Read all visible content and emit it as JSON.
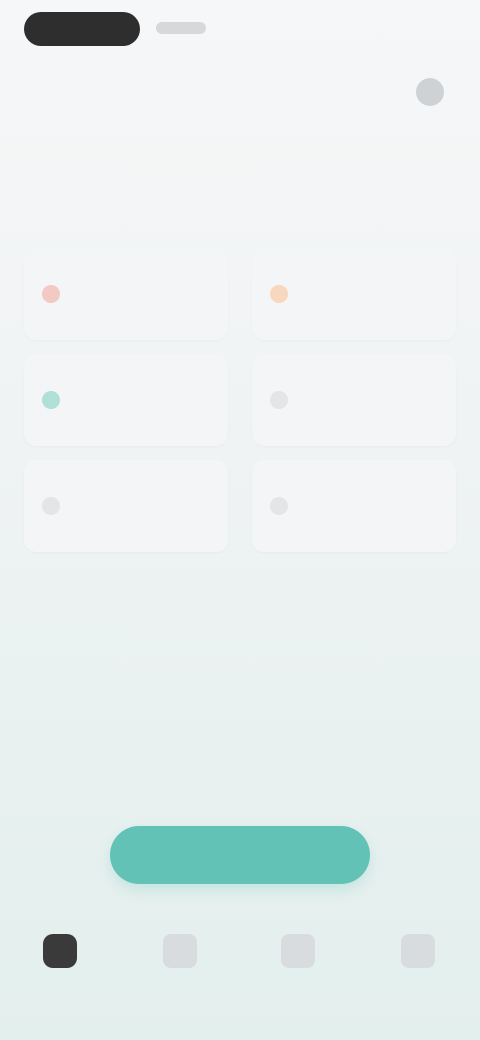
{
  "status_bar": {
    "time": "",
    "right_text": ""
  },
  "header": {
    "left_text": "",
    "right_text": ""
  },
  "section_label": "",
  "cards": [
    {
      "label": "",
      "icon": "red-circle-icon",
      "color": "#f3c9c4"
    },
    {
      "label": "",
      "icon": "orange-circle-icon",
      "color": "#f7d7be"
    },
    {
      "label": "",
      "icon": "teal-circle-icon",
      "color": "#aee0d8"
    },
    {
      "label": "",
      "icon": "gray-circle-icon",
      "color": "#e3e5e6"
    },
    {
      "label": "",
      "icon": "gray-circle-icon",
      "color": "#e3e5e6"
    },
    {
      "label": "",
      "icon": "gray-circle-icon",
      "color": "#e3e5e6"
    }
  ],
  "cta_label": "",
  "tabs": [
    {
      "label": "",
      "icon": "home-icon",
      "active": true
    },
    {
      "label": "",
      "icon": "tab-icon-2",
      "active": false
    },
    {
      "label": "",
      "icon": "tab-icon-3",
      "active": false
    },
    {
      "label": "",
      "icon": "tab-icon-4",
      "active": false
    }
  ],
  "colors": {
    "accent": "#63c2b6",
    "dark": "#2e2e2e"
  }
}
